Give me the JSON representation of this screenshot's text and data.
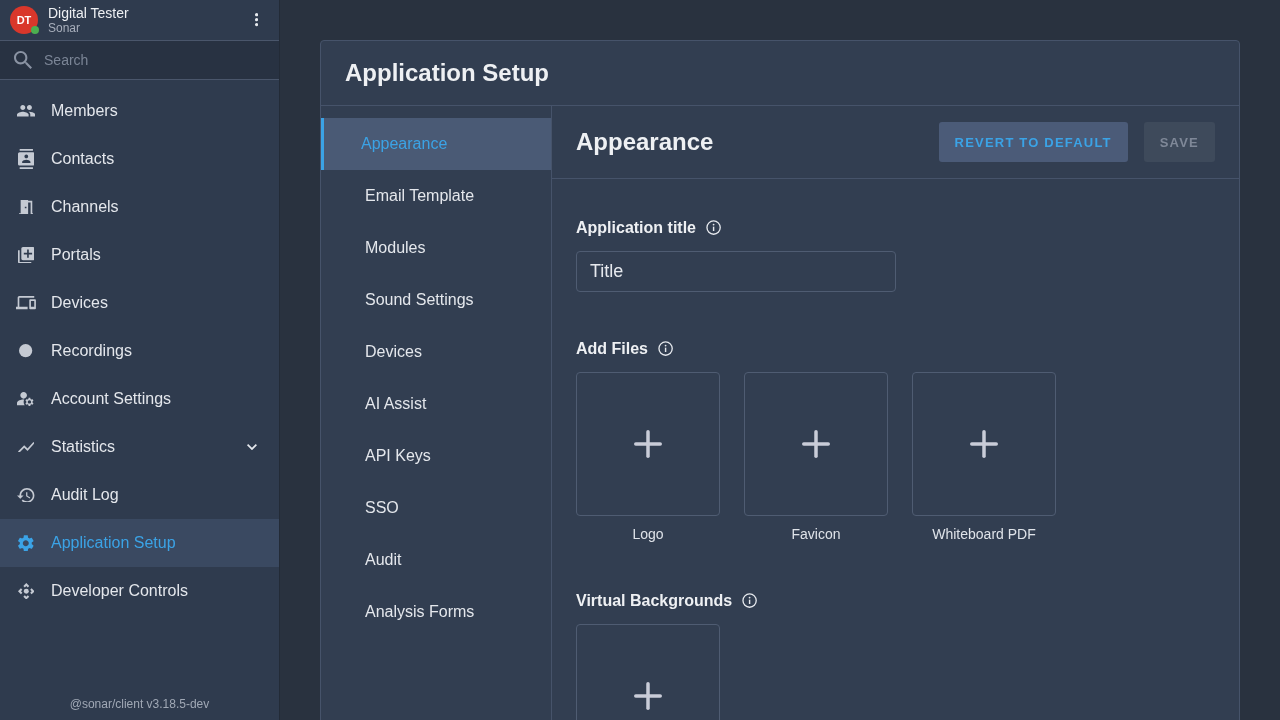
{
  "user": {
    "initials": "DT",
    "name": "Digital Tester",
    "org": "Sonar",
    "online": true
  },
  "search": {
    "placeholder": "Search"
  },
  "sidebar": {
    "items": [
      {
        "label": "Members",
        "kind": "link",
        "selected": false
      },
      {
        "label": "Contacts",
        "kind": "link",
        "selected": false
      },
      {
        "label": "Channels",
        "kind": "link",
        "selected": false
      },
      {
        "label": "Portals",
        "kind": "link",
        "selected": false
      },
      {
        "label": "Devices",
        "kind": "link",
        "selected": false
      },
      {
        "label": "Recordings",
        "kind": "link",
        "selected": false
      },
      {
        "label": "Account Settings",
        "kind": "link",
        "selected": false
      },
      {
        "label": "Statistics",
        "kind": "group",
        "selected": false,
        "expanded": false
      },
      {
        "label": "Audit Log",
        "kind": "link",
        "selected": false
      },
      {
        "label": "Application Setup",
        "kind": "link",
        "selected": true
      },
      {
        "label": "Developer Controls",
        "kind": "link",
        "selected": false
      }
    ],
    "footer": "@sonar/client v3.18.5-dev"
  },
  "page": {
    "title": "Application Setup"
  },
  "tabs": [
    {
      "label": "Appearance",
      "selected": true
    },
    {
      "label": "Email Template",
      "selected": false
    },
    {
      "label": "Modules",
      "selected": false
    },
    {
      "label": "Sound Settings",
      "selected": false
    },
    {
      "label": "Devices",
      "selected": false
    },
    {
      "label": "AI Assist",
      "selected": false
    },
    {
      "label": "API Keys",
      "selected": false
    },
    {
      "label": "SSO",
      "selected": false
    },
    {
      "label": "Audit",
      "selected": false
    },
    {
      "label": "Analysis Forms",
      "selected": false
    }
  ],
  "panel": {
    "title": "Appearance",
    "buttons": [
      {
        "label": "REVERT TO DEFAULT",
        "disabled": false
      },
      {
        "label": "SAVE",
        "disabled": true
      }
    ],
    "sections": [
      {
        "kind": "text",
        "title": "Application title",
        "value": "Title"
      },
      {
        "kind": "files",
        "title": "Add Files",
        "tiles": [
          {
            "kind": "add",
            "label": "Logo"
          },
          {
            "kind": "add",
            "label": "Favicon"
          },
          {
            "kind": "add",
            "label": "Whiteboard PDF"
          }
        ]
      },
      {
        "kind": "files",
        "title": "Virtual Backgrounds",
        "tiles": [
          {
            "kind": "add"
          }
        ]
      }
    ]
  }
}
